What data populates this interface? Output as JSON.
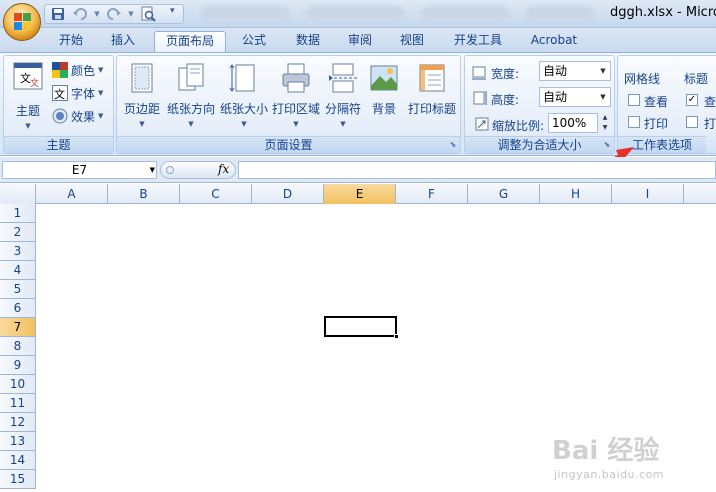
{
  "window": {
    "title": "dggh.xlsx - Micros"
  },
  "tabs": [
    {
      "label": "开始",
      "active": false
    },
    {
      "label": "插入",
      "active": false
    },
    {
      "label": "页面布局",
      "active": true
    },
    {
      "label": "公式",
      "active": false
    },
    {
      "label": "数据",
      "active": false
    },
    {
      "label": "审阅",
      "active": false
    },
    {
      "label": "视图",
      "active": false
    },
    {
      "label": "开发工具",
      "active": false
    },
    {
      "label": "Acrobat",
      "active": false
    }
  ],
  "ribbon": {
    "theme_group": {
      "label": "主题",
      "theme_button": "主题",
      "colors": "颜色",
      "fonts": "字体",
      "effects": "效果"
    },
    "page_setup_group": {
      "label": "页面设置",
      "margins": "页边距",
      "orientation": "纸张方向",
      "size": "纸张大小",
      "print_area": "打印区域",
      "breaks": "分隔符",
      "background": "背景",
      "print_titles": "打印标题"
    },
    "scale_group": {
      "label": "调整为合适大小",
      "width_label": "宽度:",
      "width_value": "自动",
      "height_label": "高度:",
      "height_value": "自动",
      "scale_label": "缩放比例:",
      "scale_value": "100%"
    },
    "sheet_options_group": {
      "label": "工作表选项",
      "gridlines_label": "网格线",
      "gridlines_view": "查看",
      "gridlines_view_checked": false,
      "gridlines_print": "打印",
      "gridlines_print_checked": false,
      "headings_label": "标题",
      "headings_view": "查",
      "headings_view_checked": true,
      "headings_print": "打",
      "headings_print_checked": false
    }
  },
  "formula_bar": {
    "name_box": "E7",
    "fx": "fx",
    "formula": ""
  },
  "grid": {
    "columns": [
      "A",
      "B",
      "C",
      "D",
      "E",
      "F",
      "G",
      "H",
      "I"
    ],
    "rows": [
      "1",
      "2",
      "3",
      "4",
      "5",
      "6",
      "7",
      "8",
      "9",
      "10",
      "11",
      "12",
      "13",
      "14",
      "15"
    ],
    "selected_column": "E",
    "selected_row": "7"
  },
  "watermark": {
    "main": "Bai 经验",
    "sub": "jingyan.baidu.com"
  },
  "colors": {
    "accent": "#15428b",
    "selected_header": "#f1c15f",
    "arrow": "#e8302a"
  }
}
